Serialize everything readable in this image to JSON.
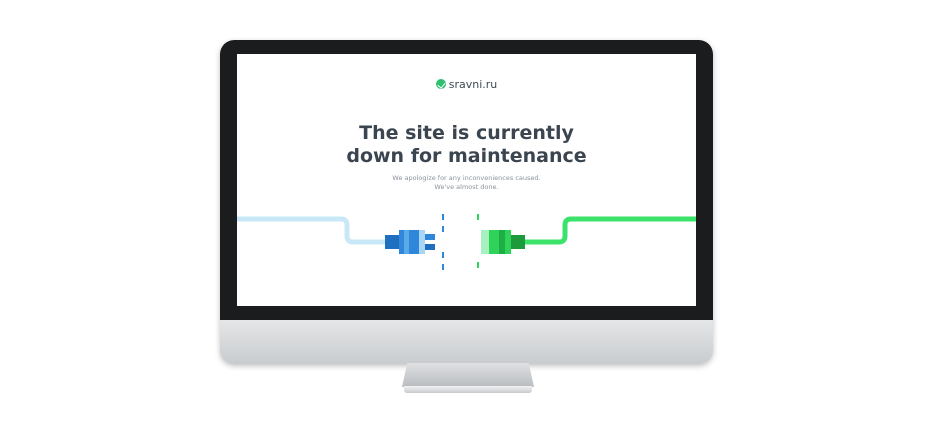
{
  "page": {
    "logo_text": "sravni.ru",
    "headline_line1": "The site is currently",
    "headline_line2": "down for maintenance",
    "subline_line1": "We apologize for any inconveniences caused.",
    "subline_line2": "We've almost done."
  },
  "colors": {
    "accent_blue": "#2f7fd0",
    "accent_green": "#2fd35a",
    "cable_blue": "#c9e8f7",
    "cable_green": "#3be36b",
    "text_dark": "#3b4550"
  },
  "icons": {
    "logo": "sravni-logo-icon",
    "plug_left": "blue-plug-icon",
    "plug_right": "green-socket-icon",
    "device": "monitor-icon"
  }
}
